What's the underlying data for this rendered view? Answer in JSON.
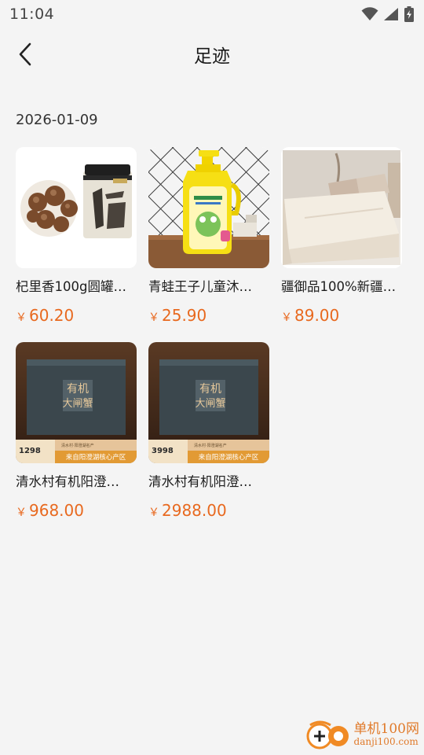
{
  "status": {
    "time": "11:04"
  },
  "nav": {
    "title": "足迹"
  },
  "date": "2026-01-09",
  "products": [
    {
      "name": "杞里香100g圆罐…",
      "currency": "￥",
      "price": "60.20"
    },
    {
      "name": "青蛙王子儿童沐…",
      "currency": "￥",
      "price": "25.90"
    },
    {
      "name": "疆御品100%新疆…",
      "currency": "￥",
      "price": "89.00"
    },
    {
      "name": "清水村有机阳澄…",
      "currency": "￥",
      "price": "968.00",
      "thumb": {
        "box_text": "有机\n大闸蟹",
        "tag_price": "1298",
        "banner": "来自阳澄湖核心产区",
        "sub_line": "清水村·阳澄湖名产"
      }
    },
    {
      "name": "清水村有机阳澄…",
      "currency": "￥",
      "price": "2988.00",
      "thumb": {
        "box_text": "有机\n大闸蟹",
        "tag_price": "3998",
        "banner": "来自阳澄湖核心产区",
        "sub_line": "清水村·阳澄湖名产"
      }
    }
  ],
  "watermark": {
    "line1": "单机100网",
    "line2": "danji100.com"
  }
}
